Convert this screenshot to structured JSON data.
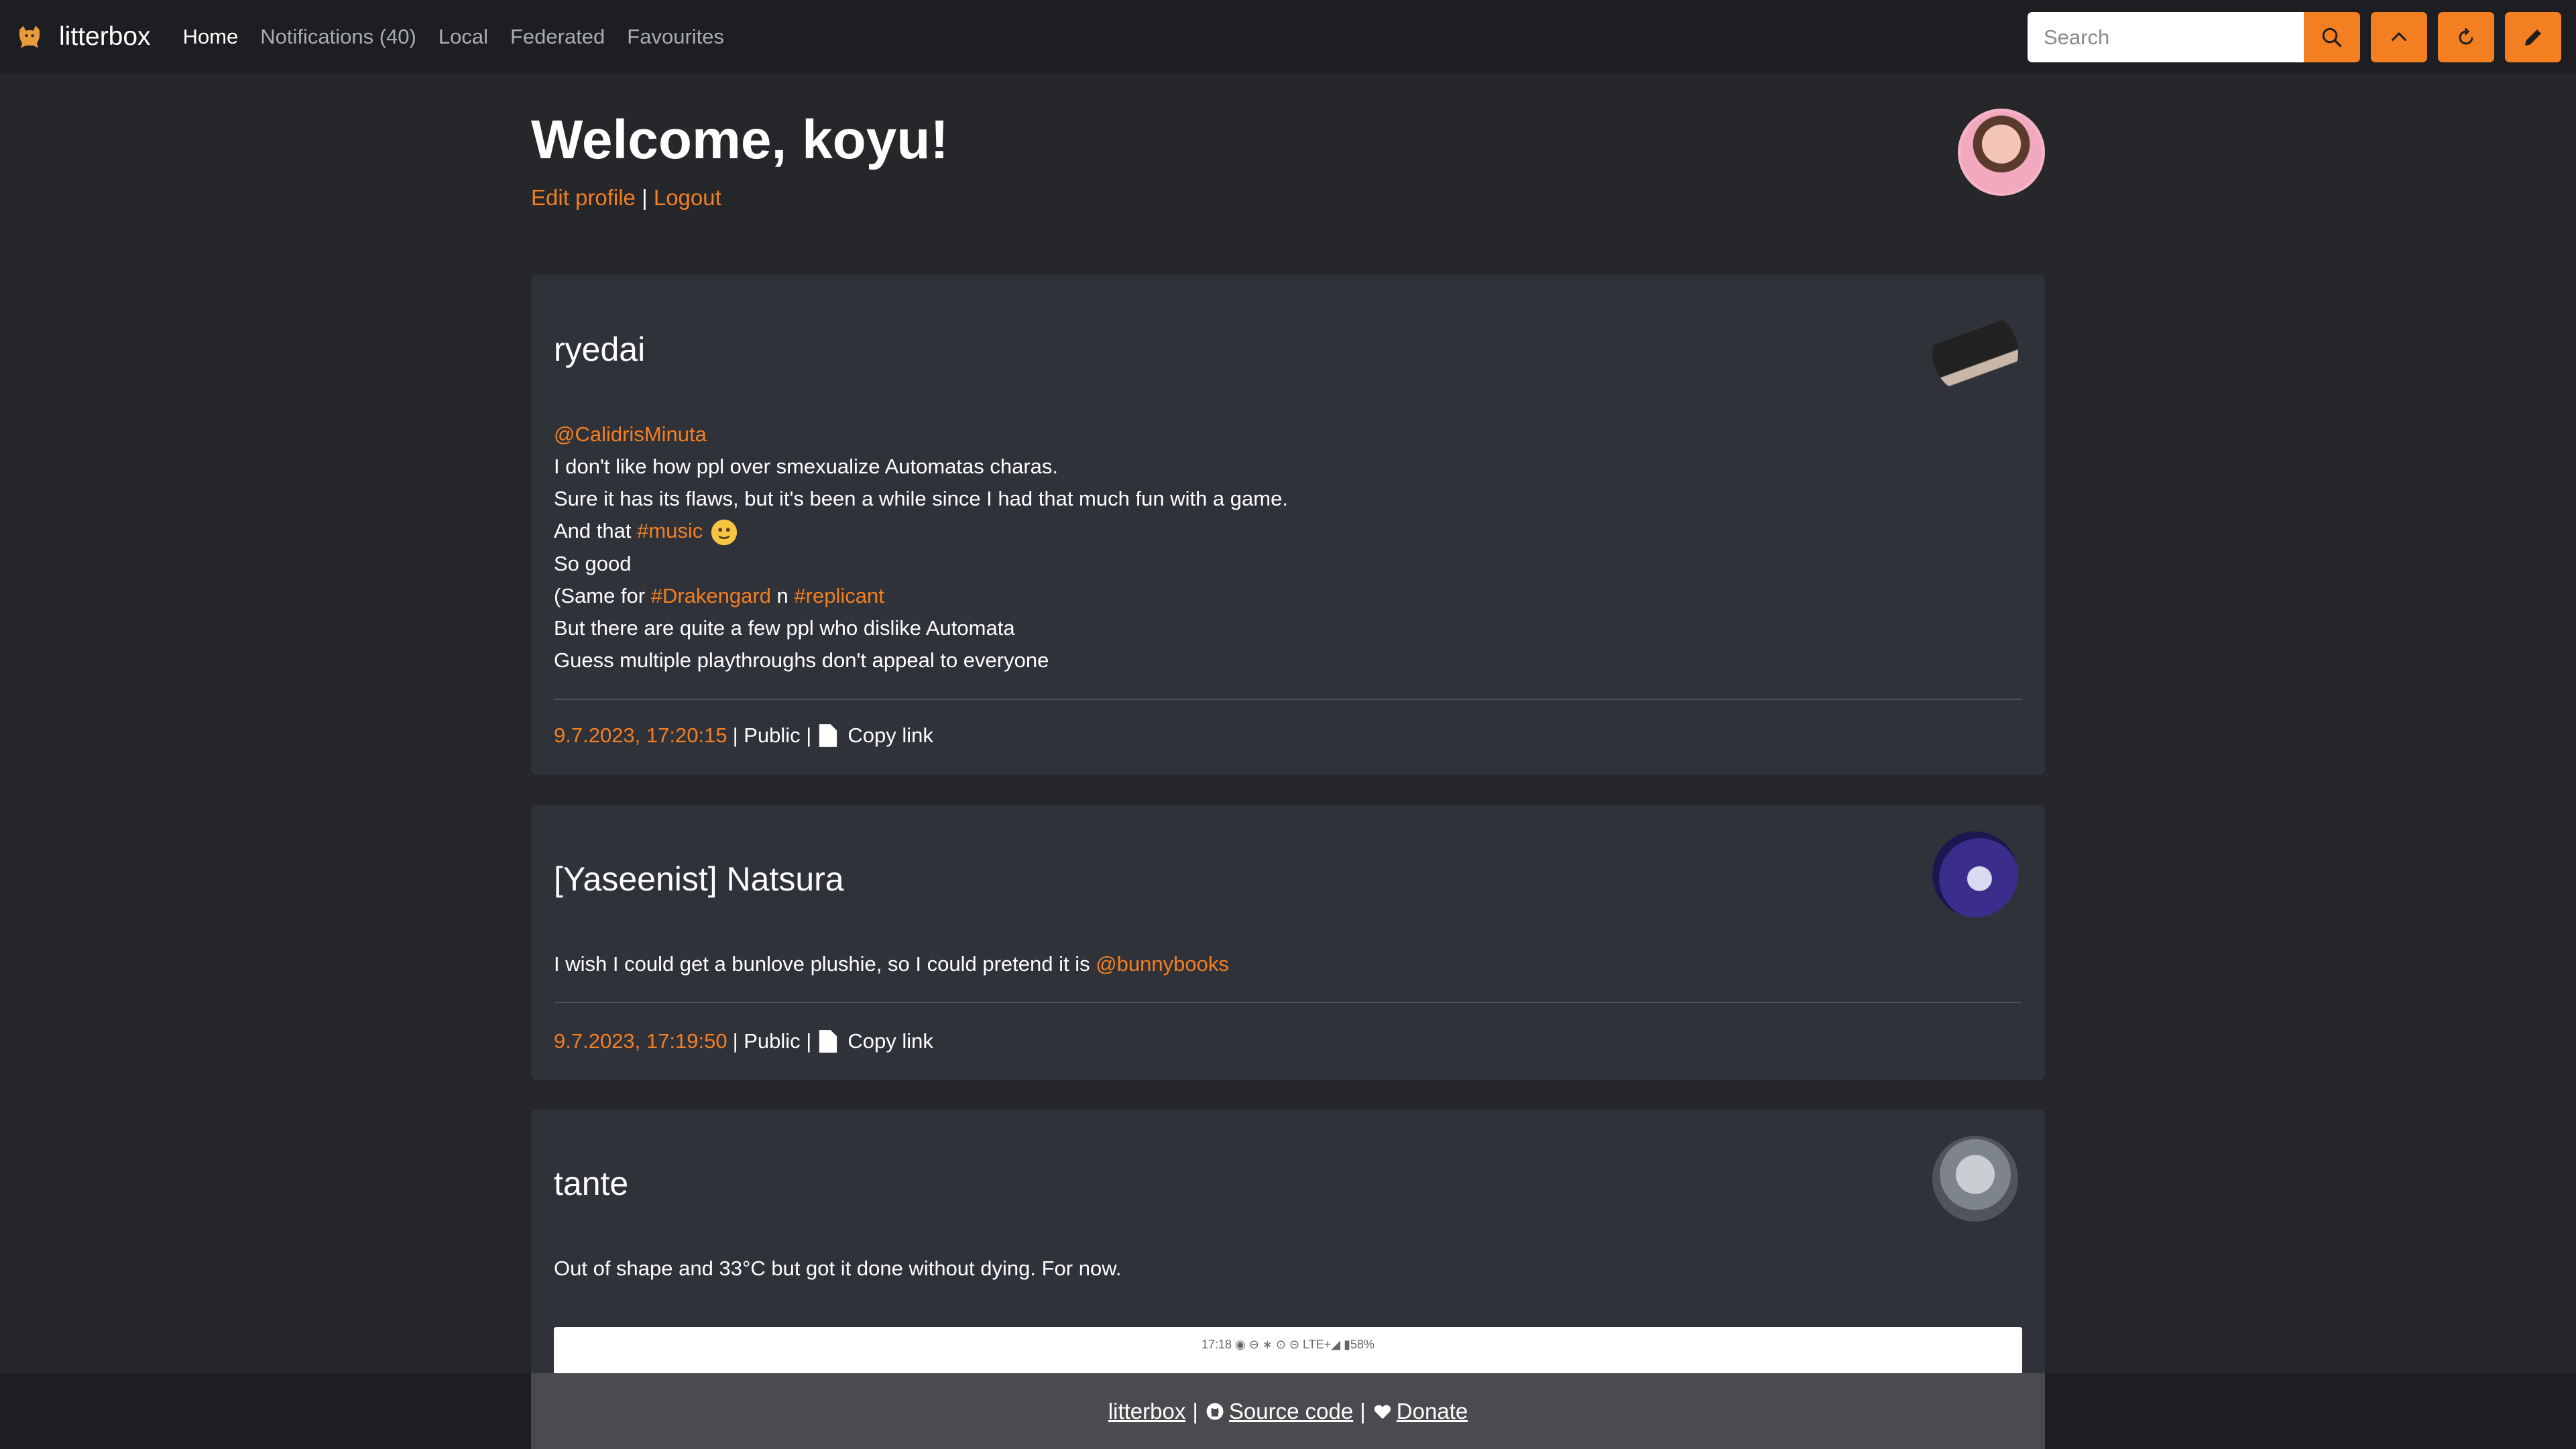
{
  "navbar": {
    "brand": "litterbox",
    "links": [
      {
        "label": "Home",
        "active": true
      },
      {
        "label": "Notifications (40)",
        "active": false
      },
      {
        "label": "Local",
        "active": false
      },
      {
        "label": "Federated",
        "active": false
      },
      {
        "label": "Favourites",
        "active": false
      }
    ],
    "search_placeholder": "Search",
    "accent_color": "#f47f20"
  },
  "header": {
    "welcome": "Welcome, koyu!",
    "edit_profile": "Edit profile",
    "separator": "|",
    "logout": "Logout"
  },
  "posts": [
    {
      "author": "ryedai",
      "mention": "@CalidrisMinuta",
      "lines": [
        "I don't like how ppl over smexualize Automatas charas.",
        "Sure it has its flaws, but it's been a while since I had that much fun with a game."
      ],
      "line3_prefix": "And that ",
      "hashtag_music": "#music",
      "line4": "So good",
      "line5_prefix": "(Same for ",
      "hashtag_drakengard": "#Drakengard",
      "line5_mid": " n ",
      "hashtag_replicant": "#replicant",
      "line6": "But there are quite a few ppl who dislike Automata",
      "line7": "Guess multiple playthroughs don't appeal to everyone",
      "timestamp": "9.7.2023, 17:20:15",
      "visibility": "| Public |",
      "copy_link": "Copy link"
    },
    {
      "author": "[Yaseenist] Natsura",
      "text": "I wish I could get a bunlove plushie, so I could pretend it is ",
      "mention": "@bunnybooks",
      "timestamp": "9.7.2023, 17:19:50",
      "visibility": "| Public |",
      "copy_link": "Copy link"
    },
    {
      "author": "tante",
      "text": "Out of shape and 33°C but got it done without dying. For now.",
      "image_status_bar": "17:18  ◉ ⊖                                ∗ ⊙ ⊝ LTE+◢ ▮58%"
    }
  ],
  "footer": {
    "home": "litterbox",
    "sep": "|",
    "source": "Source code",
    "donate": "Donate"
  }
}
